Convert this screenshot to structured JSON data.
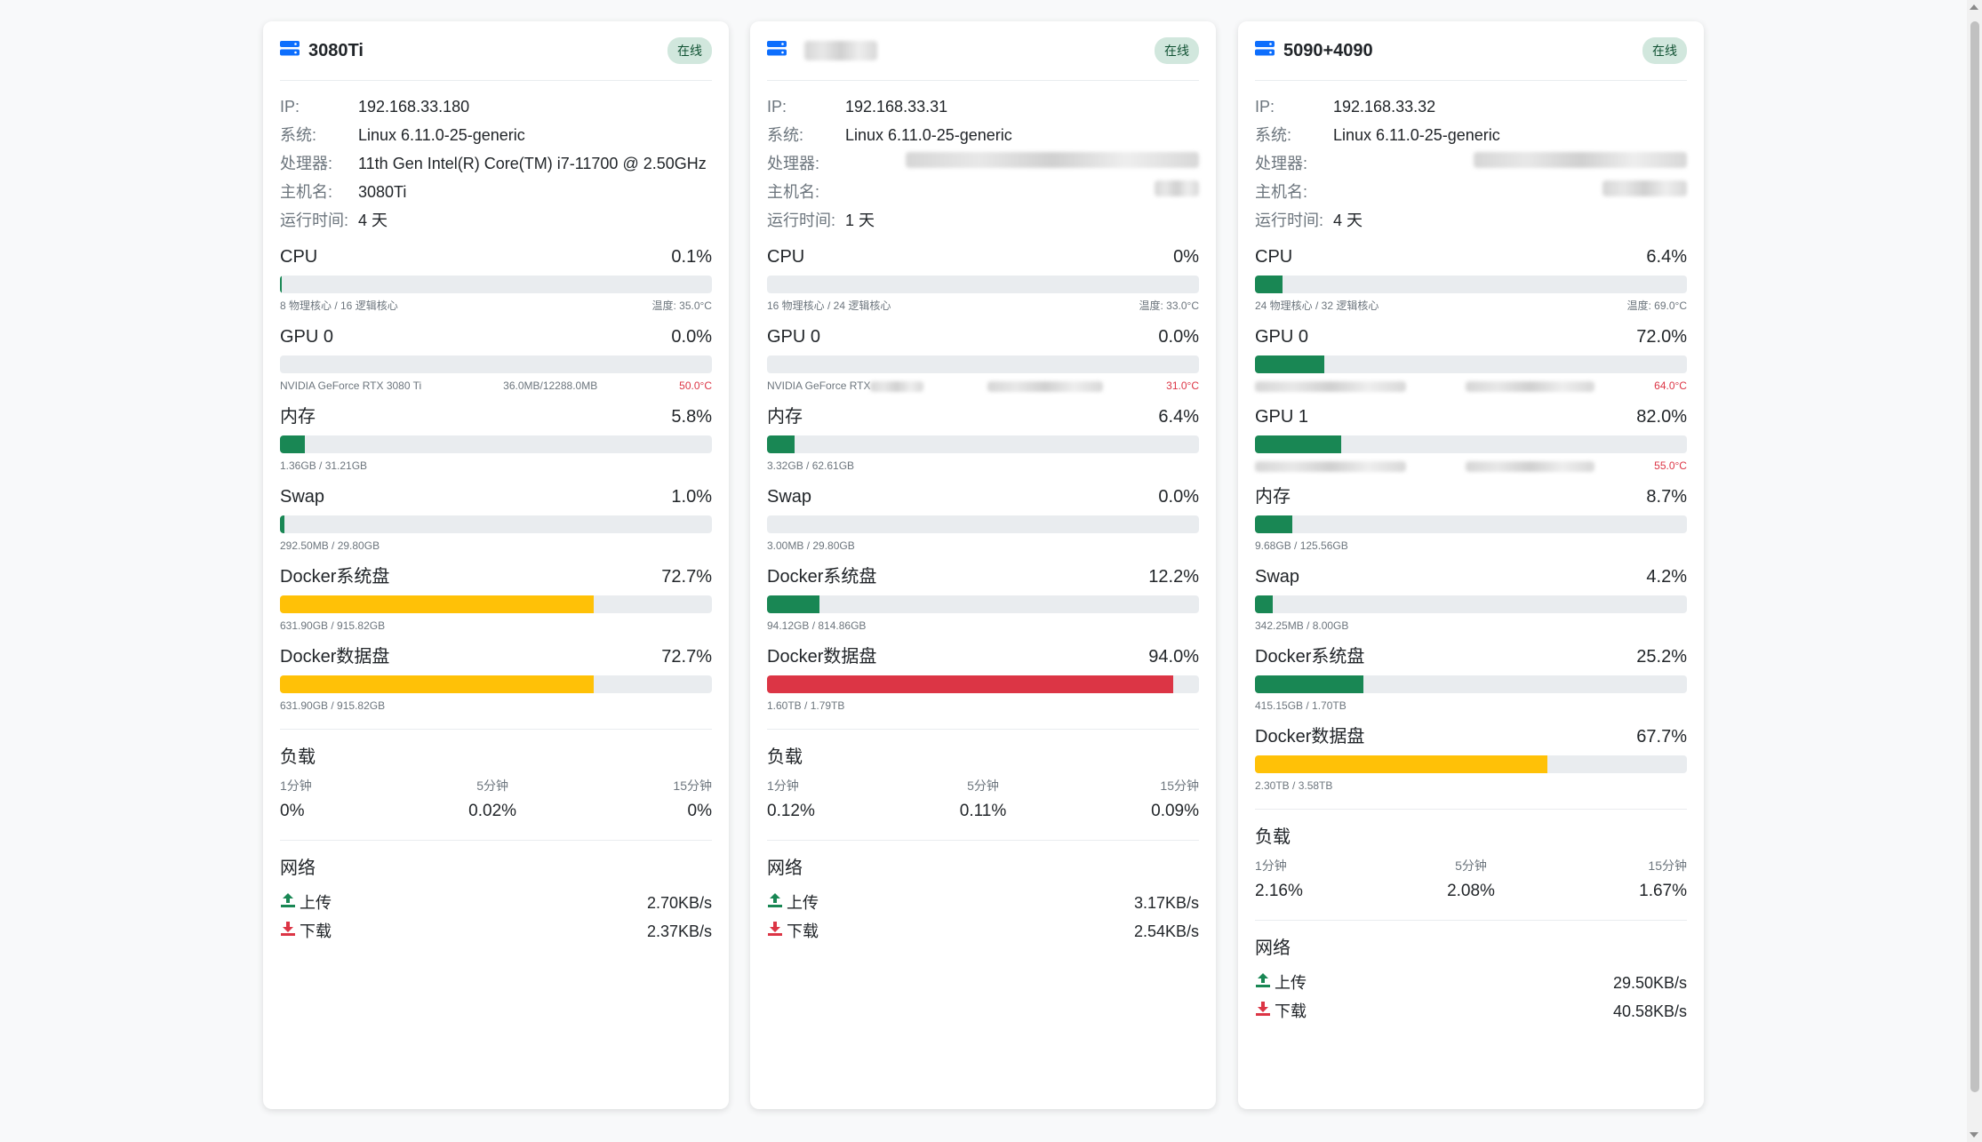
{
  "colors": {
    "green": "#198754",
    "yellow": "#ffc107",
    "red": "#dc3545",
    "online_bg": "#d1e7dd"
  },
  "labels": {
    "ip": "IP:",
    "os": "系统:",
    "cpu_model": "处理器:",
    "hostname": "主机名:",
    "uptime": "运行时间:",
    "load": "负载",
    "network": "网络",
    "upload": "上传",
    "download": "下载"
  },
  "servers": [
    {
      "name": "3080Ti",
      "status": "在线",
      "ip": "192.168.33.180",
      "os": "Linux 6.11.0-25-generic",
      "cpu_model": "11th Gen Intel(R) Core(TM) i7-11700 @ 2.50GHz",
      "hostname": "3080Ti",
      "uptime": "4 天",
      "metrics": [
        {
          "name": "CPU",
          "value": "0.1%",
          "percent": 0.1,
          "level": "green",
          "sub_left": "8 物理核心 / 16 逻辑核心",
          "sub_mid": "",
          "sub_right": "温度: 35.0°C",
          "right_red": false
        },
        {
          "name": "GPU 0",
          "value": "0.0%",
          "percent": 0.0,
          "level": "green",
          "sub_left": "NVIDIA GeForce RTX 3080 Ti",
          "sub_mid": "36.0MB/12288.0MB",
          "sub_right": "50.0°C",
          "right_red": true
        },
        {
          "name": "内存",
          "value": "5.8%",
          "percent": 5.8,
          "level": "green",
          "sub_left": "1.36GB / 31.21GB",
          "sub_mid": "",
          "sub_right": "",
          "right_red": false
        },
        {
          "name": "Swap",
          "value": "1.0%",
          "percent": 1.0,
          "level": "green",
          "sub_left": "292.50MB / 29.80GB",
          "sub_mid": "",
          "sub_right": "",
          "right_red": false
        },
        {
          "name": "Docker系统盘",
          "value": "72.7%",
          "percent": 72.7,
          "level": "yellow",
          "sub_left": "631.90GB / 915.82GB",
          "sub_mid": "",
          "sub_right": "",
          "right_red": false
        },
        {
          "name": "Docker数据盘",
          "value": "72.7%",
          "percent": 72.7,
          "level": "yellow",
          "sub_left": "631.90GB / 915.82GB",
          "sub_mid": "",
          "sub_right": "",
          "right_red": false
        }
      ],
      "load": [
        {
          "label": "1分钟",
          "value": "0%"
        },
        {
          "label": "5分钟",
          "value": "0.02%"
        },
        {
          "label": "15分钟",
          "value": "0%"
        }
      ],
      "upload": "2.70KB/s",
      "download": "2.37KB/s"
    },
    {
      "name": "",
      "status": "在线",
      "ip": "192.168.33.31",
      "os": "Linux 6.11.0-25-generic",
      "cpu_model": "",
      "hostname": "",
      "uptime": "1 天",
      "metrics": [
        {
          "name": "CPU",
          "value": "0%",
          "percent": 0,
          "level": "green",
          "sub_left": "16 物理核心 / 24 逻辑核心",
          "sub_mid": "",
          "sub_right": "温度: 33.0°C",
          "right_red": false
        },
        {
          "name": "GPU 0",
          "value": "0.0%",
          "percent": 0.0,
          "level": "green",
          "sub_left": "NVIDIA GeForce RTX",
          "sub_mid": "",
          "sub_right": "31.0°C",
          "right_red": true
        },
        {
          "name": "内存",
          "value": "6.4%",
          "percent": 6.4,
          "level": "green",
          "sub_left": "3.32GB / 62.61GB",
          "sub_mid": "",
          "sub_right": "",
          "right_red": false
        },
        {
          "name": "Swap",
          "value": "0.0%",
          "percent": 0.0,
          "level": "green",
          "sub_left": "3.00MB / 29.80GB",
          "sub_mid": "",
          "sub_right": "",
          "right_red": false
        },
        {
          "name": "Docker系统盘",
          "value": "12.2%",
          "percent": 12.2,
          "level": "green",
          "sub_left": "94.12GB / 814.86GB",
          "sub_mid": "",
          "sub_right": "",
          "right_red": false
        },
        {
          "name": "Docker数据盘",
          "value": "94.0%",
          "percent": 94.0,
          "level": "red",
          "sub_left": "1.60TB / 1.79TB",
          "sub_mid": "",
          "sub_right": "",
          "right_red": false
        }
      ],
      "load": [
        {
          "label": "1分钟",
          "value": "0.12%"
        },
        {
          "label": "5分钟",
          "value": "0.11%"
        },
        {
          "label": "15分钟",
          "value": "0.09%"
        }
      ],
      "upload": "3.17KB/s",
      "download": "2.54KB/s"
    },
    {
      "name": "5090+4090",
      "status": "在线",
      "ip": "192.168.33.32",
      "os": "Linux 6.11.0-25-generic",
      "cpu_model": "",
      "hostname": "",
      "uptime": "4 天",
      "metrics": [
        {
          "name": "CPU",
          "value": "6.4%",
          "percent": 6.4,
          "level": "green",
          "sub_left": "24 物理核心 / 32 逻辑核心",
          "sub_mid": "",
          "sub_right": "温度: 69.0°C",
          "right_red": false
        },
        {
          "name": "GPU 0",
          "value": "72.0%",
          "percent": 16.0,
          "level": "green",
          "sub_left": "",
          "sub_mid": "",
          "sub_right": "64.0°C",
          "right_red": true
        },
        {
          "name": "GPU 1",
          "value": "82.0%",
          "percent": 20.0,
          "level": "green",
          "sub_left": "",
          "sub_mid": "",
          "sub_right": "55.0°C",
          "right_red": true
        },
        {
          "name": "内存",
          "value": "8.7%",
          "percent": 8.7,
          "level": "green",
          "sub_left": "9.68GB / 125.56GB",
          "sub_mid": "",
          "sub_right": "",
          "right_red": false
        },
        {
          "name": "Swap",
          "value": "4.2%",
          "percent": 4.2,
          "level": "green",
          "sub_left": "342.25MB / 8.00GB",
          "sub_mid": "",
          "sub_right": "",
          "right_red": false
        },
        {
          "name": "Docker系统盘",
          "value": "25.2%",
          "percent": 25.2,
          "level": "green",
          "sub_left": "415.15GB / 1.70TB",
          "sub_mid": "",
          "sub_right": "",
          "right_red": false
        },
        {
          "name": "Docker数据盘",
          "value": "67.7%",
          "percent": 67.7,
          "level": "yellow",
          "sub_left": "2.30TB / 3.58TB",
          "sub_mid": "",
          "sub_right": "",
          "right_red": false
        }
      ],
      "load": [
        {
          "label": "1分钟",
          "value": "2.16%"
        },
        {
          "label": "5分钟",
          "value": "2.08%"
        },
        {
          "label": "15分钟",
          "value": "1.67%"
        }
      ],
      "upload": "29.50KB/s",
      "download": "40.58KB/s"
    }
  ]
}
